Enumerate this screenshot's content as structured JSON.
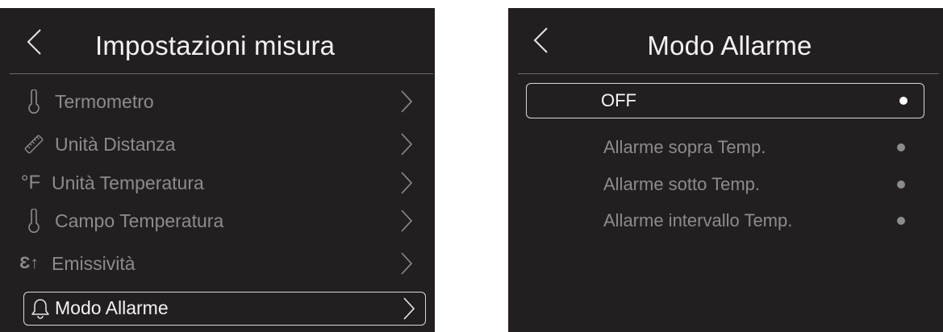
{
  "left_screen": {
    "title": "Impostazioni misura",
    "menu": [
      {
        "label": "Termometro",
        "icon": "thermometer-icon"
      },
      {
        "label": "Unità Distanza",
        "icon": "ruler-icon"
      },
      {
        "label": "Unità Temperatura",
        "icon": "degree-f-icon",
        "icon_text": "°F"
      },
      {
        "label": "Campo Temperatura",
        "icon": "thermometer-icon"
      },
      {
        "label": "Emissività",
        "icon": "emissivity-icon",
        "icon_text": "Ɛ↑"
      },
      {
        "label": "Modo Allarme",
        "icon": "bell-icon",
        "selected": true
      }
    ]
  },
  "right_screen": {
    "title": "Modo Allarme",
    "options": [
      {
        "label": "OFF",
        "selected": true
      },
      {
        "label": "Allarme sopra Temp.",
        "selected": false
      },
      {
        "label": "Allarme sotto Temp.",
        "selected": false
      },
      {
        "label": "Allarme intervallo Temp.",
        "selected": false
      }
    ]
  },
  "colors": {
    "screen_bg": "#231f20",
    "text_active": "#f2f2f2",
    "text_inactive": "#8c8c8c",
    "selection_border": "#d9d9d9"
  }
}
